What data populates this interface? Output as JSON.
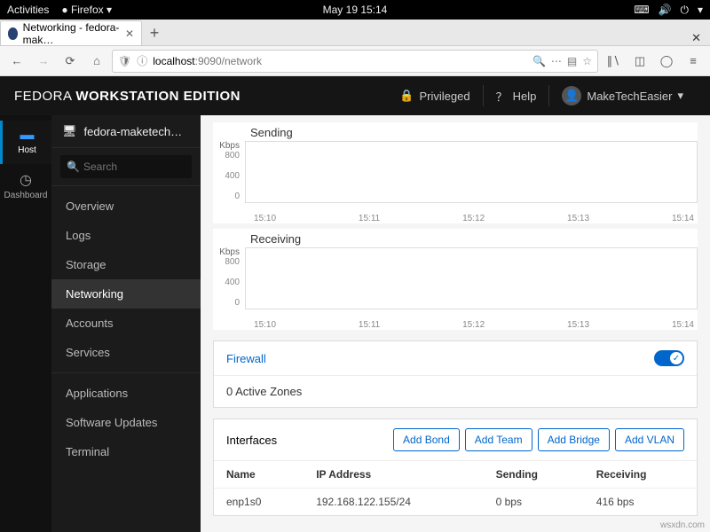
{
  "topbar": {
    "activities": "Activities",
    "app": "Firefox",
    "clock": "May 19  15:14"
  },
  "browser": {
    "tab_title": "Networking - fedora-mak…",
    "url_prefix": "localhost",
    "url_rest": ":9090/network"
  },
  "header": {
    "brand_thin": "FEDORA ",
    "brand_bold": "WORKSTATION EDITION",
    "privileged": "Privileged",
    "help": "Help",
    "user": "MakeTechEasier"
  },
  "rail": {
    "host": "Host",
    "dashboard": "Dashboard"
  },
  "sidenav": {
    "host_label": "fedora-maketech…",
    "search_placeholder": "Search",
    "items": [
      "Overview",
      "Logs",
      "Storage",
      "Networking",
      "Accounts",
      "Services"
    ],
    "items2": [
      "Applications",
      "Software Updates",
      "Terminal"
    ],
    "active": "Networking"
  },
  "chart_data": [
    {
      "type": "line",
      "title": "Sending",
      "unit": "Kbps",
      "y_ticks": [
        800,
        400,
        0
      ],
      "x_ticks": [
        "15:10",
        "15:11",
        "15:12",
        "15:13",
        "15:14"
      ],
      "series": [
        {
          "name": "Sending",
          "values": [
            0,
            0,
            0,
            0,
            0
          ]
        }
      ],
      "ylim": [
        0,
        800
      ]
    },
    {
      "type": "line",
      "title": "Receiving",
      "unit": "Kbps",
      "y_ticks": [
        800,
        400,
        0
      ],
      "x_ticks": [
        "15:10",
        "15:11",
        "15:12",
        "15:13",
        "15:14"
      ],
      "series": [
        {
          "name": "Receiving",
          "values": [
            0,
            0,
            0,
            0,
            0
          ]
        }
      ],
      "ylim": [
        0,
        800
      ]
    }
  ],
  "firewall": {
    "title": "Firewall",
    "status": "0 Active Zones",
    "enabled": true
  },
  "interfaces": {
    "title": "Interfaces",
    "buttons": [
      "Add Bond",
      "Add Team",
      "Add Bridge",
      "Add VLAN"
    ],
    "columns": [
      "Name",
      "IP Address",
      "Sending",
      "Receiving"
    ],
    "rows": [
      {
        "name": "enp1s0",
        "ip": "192.168.122.155/24",
        "sending": "0 bps",
        "receiving": "416 bps"
      }
    ]
  },
  "watermark": "wsxdn.com"
}
